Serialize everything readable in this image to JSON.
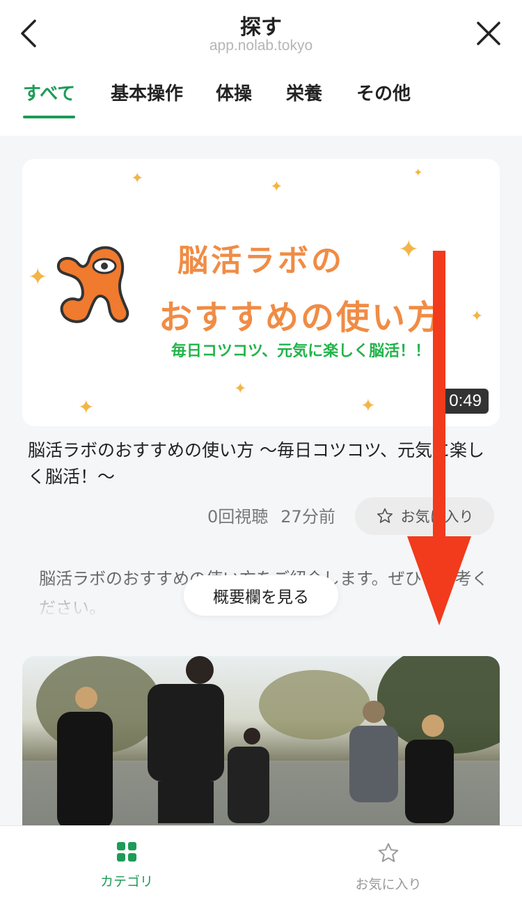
{
  "header": {
    "title": "探す",
    "url": "app.nolab.tokyo"
  },
  "tabs": [
    {
      "label": "すべて",
      "active": true
    },
    {
      "label": "基本操作",
      "active": false
    },
    {
      "label": "体操",
      "active": false
    },
    {
      "label": "栄養",
      "active": false
    },
    {
      "label": "その他",
      "active": false
    }
  ],
  "video1": {
    "thumbnail": {
      "title_line1": "脳活ラボの",
      "title_line2": "おすすめの使い方",
      "subtitle": "毎日コツコツ、元気に楽しく脳活！！",
      "duration": "0:49"
    },
    "title": "脳活ラボのおすすめの使い方 〜毎日コツコツ、元気に楽しく脳活！〜",
    "views": "0回視聴",
    "posted": "27分前",
    "favorite_label": "お気に入り",
    "description": "脳活ラボのおすすめの使い方をご紹介します。ぜひご参考ください。",
    "see_description_label": "概要欄を見る"
  },
  "bottom_nav": {
    "items": [
      {
        "label": "カテゴリ",
        "icon": "grid-icon",
        "active": true
      },
      {
        "label": "お気に入り",
        "icon": "star-icon",
        "active": false
      }
    ]
  },
  "colors": {
    "accent": "#1d9b57",
    "annotation_arrow": "#f23a1c"
  }
}
